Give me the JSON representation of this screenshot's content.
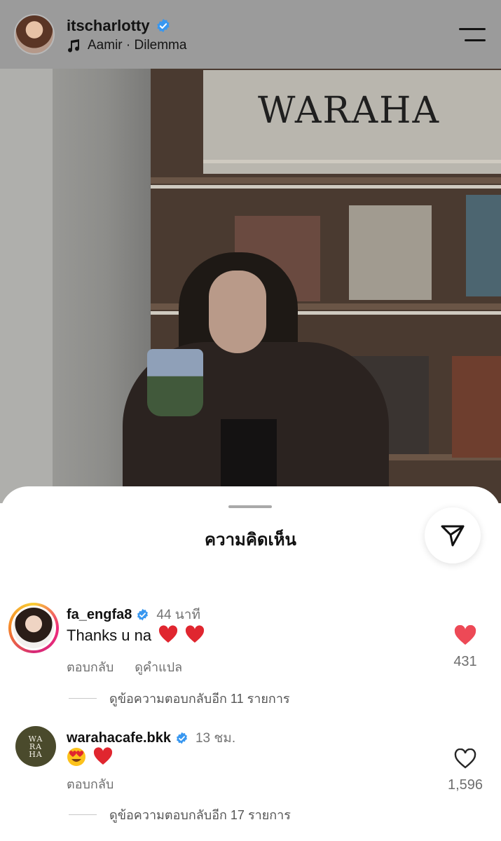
{
  "header": {
    "username": "itscharlotty",
    "music": "Aamir · Dilemma"
  },
  "photo": {
    "sign_text": "WARAHA"
  },
  "sheet": {
    "title": "ความคิดเห็น"
  },
  "comments": [
    {
      "username": "fa_engfa8",
      "time": "44 นาที",
      "text": "Thanks u na",
      "reply_label": "ตอบกลับ",
      "translate_label": "ดูคำแปล",
      "likes": "431",
      "liked": true,
      "view_replies": "ดูข้อความตอบกลับอีก 11 รายการ"
    },
    {
      "username": "warahacafe.bkk",
      "avatar_text": "WA RA HA",
      "time": "13 ชม.",
      "text": "",
      "reply_label": "ตอบกลับ",
      "likes": "1,596",
      "liked": false,
      "view_replies": "ดูข้อความตอบกลับอีก 17 รายการ"
    }
  ],
  "colors": {
    "liked_heart": "#ed4956",
    "verified": "#3897f0",
    "overlay": "#9b9b9b"
  },
  "icons": [
    "music-note-icon",
    "verified-badge-icon",
    "menu-icon",
    "send-icon",
    "heart-filled-icon",
    "heart-outline-icon",
    "red-heart-emoji",
    "heart-eyes-emoji"
  ]
}
